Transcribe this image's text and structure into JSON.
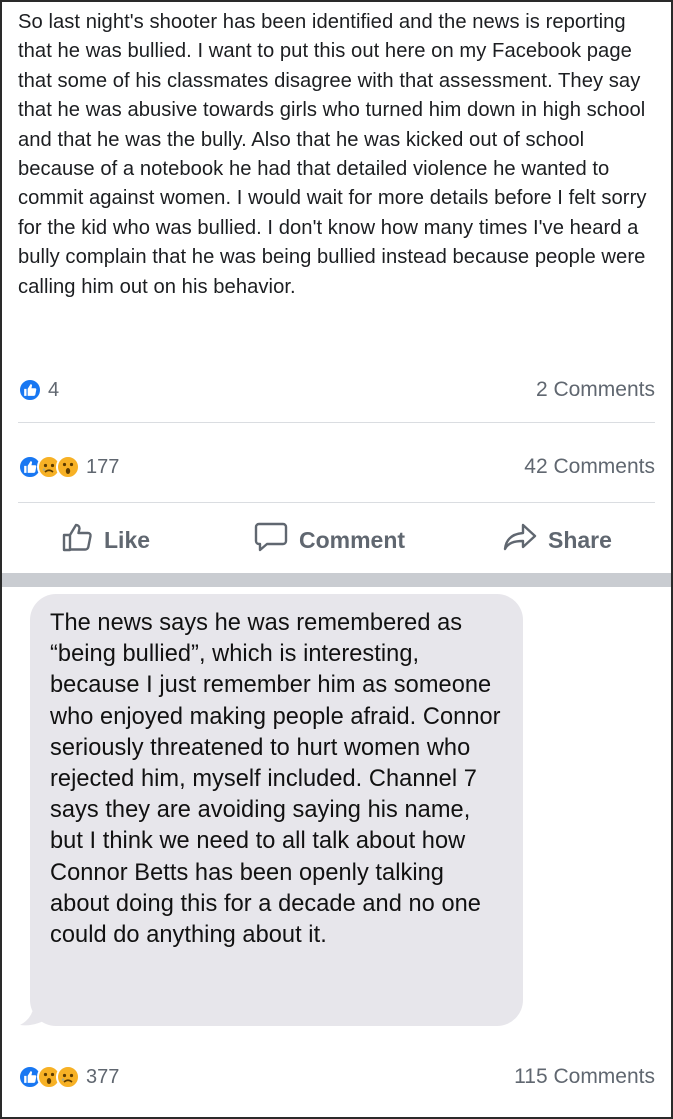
{
  "post": {
    "text": "So last night's shooter has been identified and the news is reporting that he was bullied. I want to put this out here on my Facebook page that some of his classmates disagree with that assessment. They say that he was abusive towards girls who turned him down in high school and that he was the bully. Also that he was kicked out of school because of a notebook he had that detailed violence he wanted to commit against women. I would wait for more details before I felt sorry for the kid who was bullied. I don't know how many times I've heard a bully complain that he was being bullied instead because people were calling him out on his behavior.",
    "reaction_count": "4",
    "comments": "2 Comments"
  },
  "shared_post": {
    "reaction_count": "177",
    "comments": "42 Comments"
  },
  "actions": {
    "like": "Like",
    "comment": "Comment",
    "share": "Share"
  },
  "message": {
    "text": "The news says he was remembered as “being bullied”, which is interesting, because I just remember him as someone who enjoyed making people afraid. Connor seriously threatened to hurt women who rejected him, myself included. Channel 7 says they are avoiding saying his name, but I think we need to all talk about how Connor Betts has been openly talking about doing this for a decade and no one could do anything about it."
  },
  "bottom_post": {
    "reaction_count": "377",
    "comments": "115 Comments"
  },
  "colors": {
    "like_blue": "#1877f2",
    "emoji_yellow": "#f7b125",
    "text_gray": "#606770",
    "bubble_gray": "#e7e6eb"
  },
  "icons": [
    "like-reaction-icon",
    "sad-reaction-icon",
    "wow-reaction-icon",
    "thumbs-up-icon",
    "comment-bubble-icon",
    "share-arrow-icon"
  ]
}
